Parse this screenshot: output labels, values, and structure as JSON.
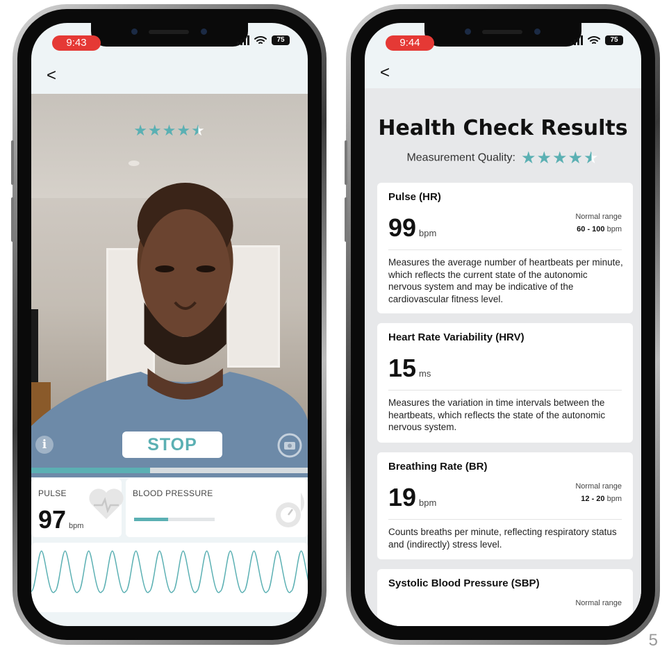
{
  "left": {
    "status": {
      "time": "9:43",
      "battery": "75"
    },
    "back_label": "<",
    "quality_stars": 4.5,
    "stop_label": "STOP",
    "progress": 0.43,
    "pulse": {
      "label": "PULSE",
      "value": "97",
      "unit": "bpm"
    },
    "blood_pressure": {
      "label": "BLOOD PRESSURE",
      "progress": 0.42
    }
  },
  "right": {
    "status": {
      "time": "9:44",
      "battery": "75"
    },
    "back_label": "<",
    "title": "Health Check Results",
    "quality_label": "Measurement Quality:",
    "quality_stars": 4.5,
    "cards": [
      {
        "title": "Pulse (HR)",
        "value": "99",
        "unit": "bpm",
        "range_label": "Normal range",
        "range": "60 - 100",
        "range_unit": "bpm",
        "desc": "Measures the average number of heartbeats per minute, which reflects the current state of the autonomic nervous system and may be indicative of the cardiovascular fitness level."
      },
      {
        "title": "Heart Rate Variability (HRV)",
        "value": "15",
        "unit": "ms",
        "desc": "Measures the variation in time intervals between the heartbeats, which reflects the state of the autonomic nervous system."
      },
      {
        "title": "Breathing Rate (BR)",
        "value": "19",
        "unit": "bpm",
        "range_label": "Normal range",
        "range": "12 - 20",
        "range_unit": "bpm",
        "desc": "Counts breaths per minute, reflecting respiratory status and (indirectly) stress level."
      },
      {
        "title": "Systolic Blood Pressure (SBP)",
        "range_label": "Normal range"
      }
    ]
  },
  "page_number": "5",
  "colors": {
    "accent": "#5bb0b3",
    "time_pill": "#e53935"
  }
}
